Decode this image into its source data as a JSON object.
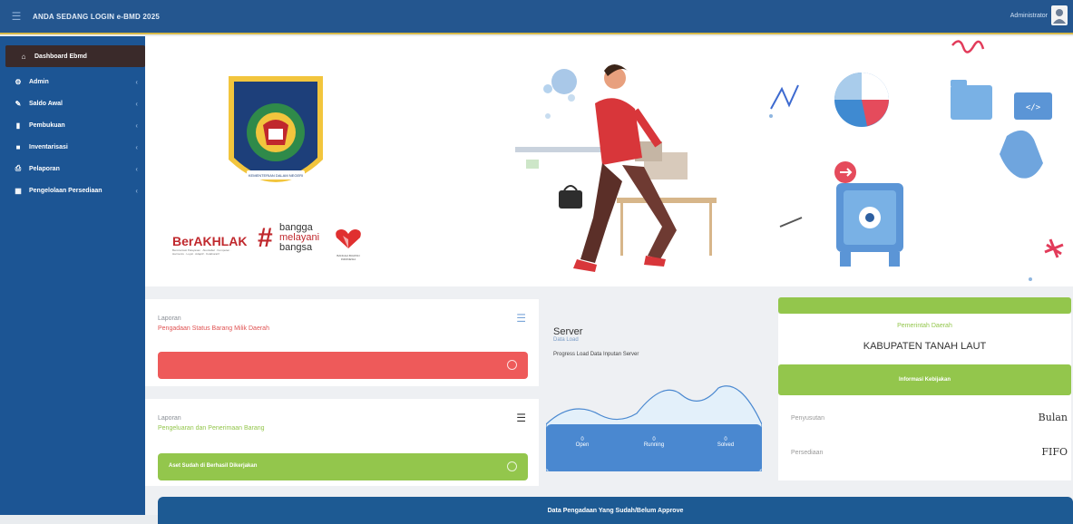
{
  "topbar": {
    "login_text": "ANDA SEDANG LOGIN e-BMD 2025",
    "user_name": "Administrator",
    "colors": {
      "bar": "#24568f",
      "accent": "#d6b94a"
    }
  },
  "sidebar": {
    "items": [
      {
        "label": "Dashboard Ebmd",
        "icon": "home-icon",
        "active": true
      },
      {
        "label": "Admin",
        "icon": "gear-icon"
      },
      {
        "label": "Saldo Awal",
        "icon": "edit-icon"
      },
      {
        "label": "Pembukuan",
        "icon": "book-icon"
      },
      {
        "label": "Inventarisasi",
        "icon": "box-icon"
      },
      {
        "label": "Pelaporan",
        "icon": "printer-icon"
      },
      {
        "label": "Pengelolaan Persediaan",
        "icon": "grid-icon"
      }
    ]
  },
  "hero": {
    "berakhlak": "BerAKHLAK",
    "bangga_line1": "bangga",
    "bangga_line2": "melayani",
    "bangga_line3": "bangsa",
    "berakhlak_sub": "Berorientasi Pelayanan · Akuntabel · Kompeten · Harmonis · Loyal · Adaptif · Kolaboratif",
    "bangga_sub": "BANGGA BUATAN INDONESIA",
    "emblem_caption": "KEMENTERIAN DALAM NEGERI"
  },
  "laporan1": {
    "label": "Laporan",
    "title": "Pengadaan Status Barang Milik Daerah",
    "bar_text": "",
    "title_color": "#e05353"
  },
  "laporan2": {
    "label": "Laporan",
    "title": "Pengeluaran dan Penerimaan Barang",
    "bar_text": "Aset Sudah di Berhasil Dikerjakan",
    "title_color": "#93c64c"
  },
  "server": {
    "title": "Server",
    "subtitle": "Data Load",
    "progress": "Progress Load Data Inputan Server",
    "stats": [
      {
        "value": "0",
        "label": "Open"
      },
      {
        "value": "0",
        "label": "Running"
      },
      {
        "value": "0",
        "label": "Solved"
      }
    ]
  },
  "pemda": {
    "title": "Pemerintah Daerah",
    "name": "KABUPATEN TANAH LAUT",
    "info_button": "Informasi Kebijakan",
    "rows": [
      {
        "label": "Penyusutan",
        "value": "Bulan"
      },
      {
        "label": "Persediaan",
        "value": "FIFO"
      }
    ]
  },
  "bottom": {
    "banner": "Data Pengadaan Yang Sudah/Belum Approve"
  }
}
